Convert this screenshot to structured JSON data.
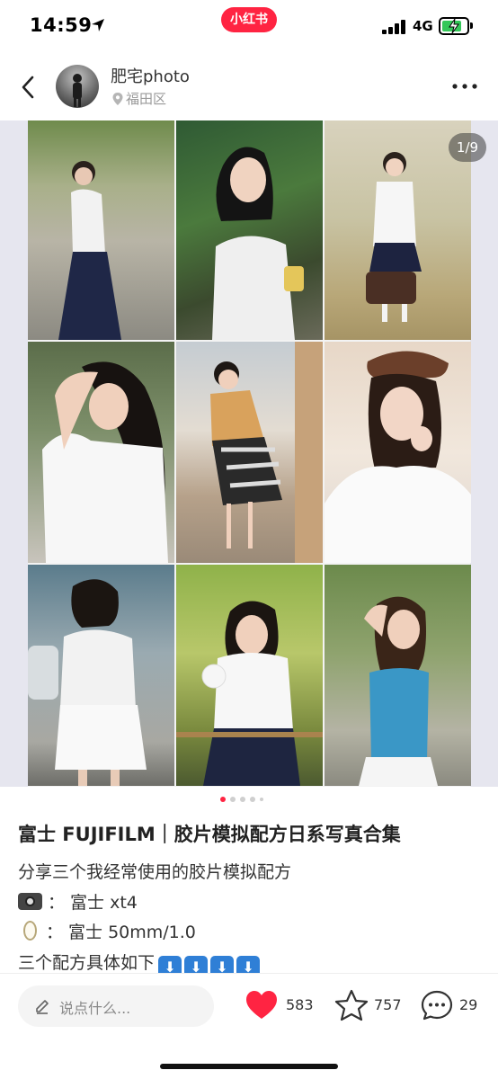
{
  "status_bar": {
    "time": "14:59",
    "app_badge": "小红书",
    "network": "4G",
    "battery_level": 0.8
  },
  "header": {
    "author_name": "肥宅photo",
    "location": "福田区"
  },
  "gallery": {
    "counter": "1/9",
    "current_page": 1,
    "total_pages": 9,
    "dot_count": 5
  },
  "post": {
    "title": "富士 FUJIFILM｜胶片模拟配方日系写真合集",
    "line1": "分享三个我经常使用的胶片模拟配方",
    "line2": "：  富士 xt4",
    "line3": "：  富士 50mm/1.0",
    "line4": "三个配方具体如下",
    "arrow_glyph": "⬇"
  },
  "bottom_bar": {
    "comment_placeholder": "说点什么...",
    "likes": "583",
    "collects": "757",
    "comments": "29"
  },
  "colors": {
    "brand_red": "#ff2442",
    "like_red": "#ff2442",
    "emoji_blue": "#2f7fd6"
  }
}
